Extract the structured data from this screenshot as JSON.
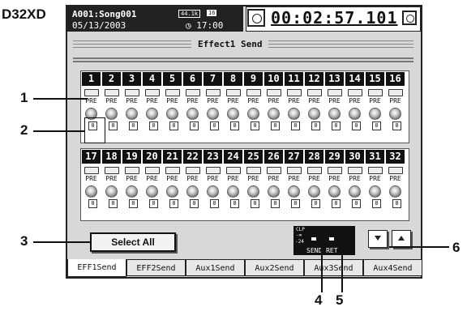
{
  "device": {
    "name": "D32XD"
  },
  "status": {
    "song": "A001:Song001",
    "sample_rate": "44.1k",
    "bits": "16",
    "date": "05/13/2003",
    "time": "◷ 17:00",
    "counter": "00:02:57.101"
  },
  "screen": {
    "title": "Effect1 Send"
  },
  "channels_bank1": [
    {
      "num": "1",
      "mode": "PRE",
      "level": "0"
    },
    {
      "num": "2",
      "mode": "PRE",
      "level": "0"
    },
    {
      "num": "3",
      "mode": "PRE",
      "level": "0"
    },
    {
      "num": "4",
      "mode": "PRE",
      "level": "0"
    },
    {
      "num": "5",
      "mode": "PRE",
      "level": "0"
    },
    {
      "num": "6",
      "mode": "PRE",
      "level": "0"
    },
    {
      "num": "7",
      "mode": "PRE",
      "level": "0"
    },
    {
      "num": "8",
      "mode": "PRE",
      "level": "0"
    },
    {
      "num": "9",
      "mode": "PRE",
      "level": "0"
    },
    {
      "num": "10",
      "mode": "PRE",
      "level": "0"
    },
    {
      "num": "11",
      "mode": "PRE",
      "level": "0"
    },
    {
      "num": "12",
      "mode": "PRE",
      "level": "0"
    },
    {
      "num": "13",
      "mode": "PRE",
      "level": "0"
    },
    {
      "num": "14",
      "mode": "PRE",
      "level": "0"
    },
    {
      "num": "15",
      "mode": "PRE",
      "level": "0"
    },
    {
      "num": "16",
      "mode": "PRE",
      "level": "0"
    }
  ],
  "channels_bank2": [
    {
      "num": "17",
      "mode": "PRE",
      "level": "0"
    },
    {
      "num": "18",
      "mode": "PRE",
      "level": "0"
    },
    {
      "num": "19",
      "mode": "PRE",
      "level": "0"
    },
    {
      "num": "20",
      "mode": "PRE",
      "level": "0"
    },
    {
      "num": "21",
      "mode": "PRE",
      "level": "0"
    },
    {
      "num": "22",
      "mode": "PRE",
      "level": "0"
    },
    {
      "num": "23",
      "mode": "PRE",
      "level": "0"
    },
    {
      "num": "24",
      "mode": "PRE",
      "level": "0"
    },
    {
      "num": "25",
      "mode": "PRE",
      "level": "0"
    },
    {
      "num": "26",
      "mode": "PRE",
      "level": "0"
    },
    {
      "num": "27",
      "mode": "PRE",
      "level": "0"
    },
    {
      "num": "28",
      "mode": "PRE",
      "level": "0"
    },
    {
      "num": "29",
      "mode": "PRE",
      "level": "0"
    },
    {
      "num": "30",
      "mode": "PRE",
      "level": "0"
    },
    {
      "num": "31",
      "mode": "PRE",
      "level": "0"
    },
    {
      "num": "32",
      "mode": "PRE",
      "level": "0"
    }
  ],
  "select_all": {
    "label": "Select All"
  },
  "meter": {
    "clip": "CLP",
    "inf": "-∞",
    "db": "-24",
    "label": "SEND RET"
  },
  "tabs": [
    "EFF1Send",
    "EFF2Send",
    "Aux1Send",
    "Aux2Send",
    "Aux3Send",
    "Aux4Send"
  ],
  "callouts": [
    "1",
    "2",
    "3",
    "4",
    "5",
    "6"
  ]
}
